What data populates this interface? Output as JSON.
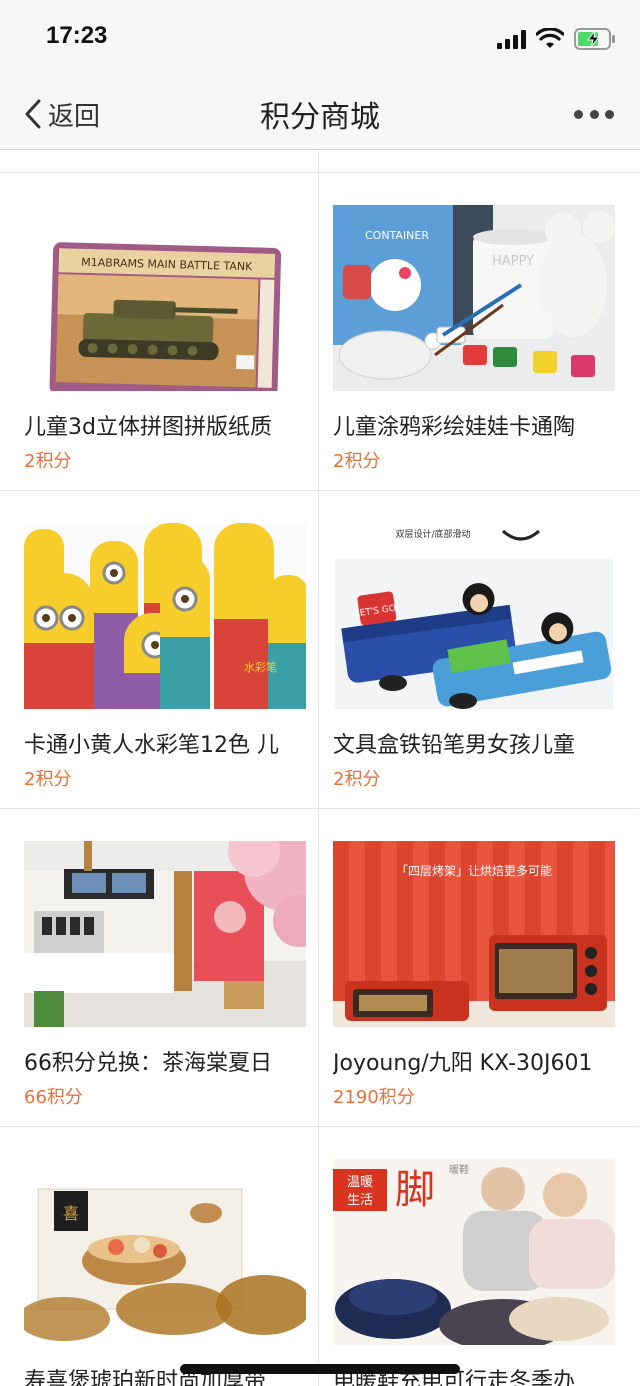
{
  "status": {
    "time": "17:23"
  },
  "nav": {
    "back_label": "返回",
    "title": "积分商城"
  },
  "products": [
    {
      "title": "儿童3d立体拼图拼版纸质",
      "points": "2积分"
    },
    {
      "title": "儿童涂鸦彩绘娃娃卡通陶",
      "points": "2积分"
    },
    {
      "title": "卡通小黄人水彩笔12色 儿",
      "points": "2积分"
    },
    {
      "title": "文具盒铁铅笔男女孩儿童",
      "points": "2积分"
    },
    {
      "title": "66积分兑换：茶海棠夏日",
      "points": "66积分"
    },
    {
      "title": "Joyoung/九阳 KX-30J601",
      "points": "2190积分"
    },
    {
      "title": "寿喜煲琥珀新时尚加厚带",
      "points": ""
    },
    {
      "title": "电暖鞋充电可行走冬季办",
      "points": ""
    }
  ],
  "image_text": {
    "tank_box": "M1ABRAMS MAIN BATTLE TANK",
    "paint_box": "CONTAINER",
    "mug_text": "HAPPY",
    "pencil_case_caption": "双层设计/底部滑动",
    "pencil_case_badge": "LET'S GO!",
    "oven_caption": "「四层烤架」让烘焙更多可能",
    "slipper_badge_1": "温暖",
    "slipper_badge_2": "生活",
    "slipper_big": "脚",
    "slipper_small": "暖鞋",
    "pot_label": "喜",
    "marker_label": "水彩笔"
  }
}
